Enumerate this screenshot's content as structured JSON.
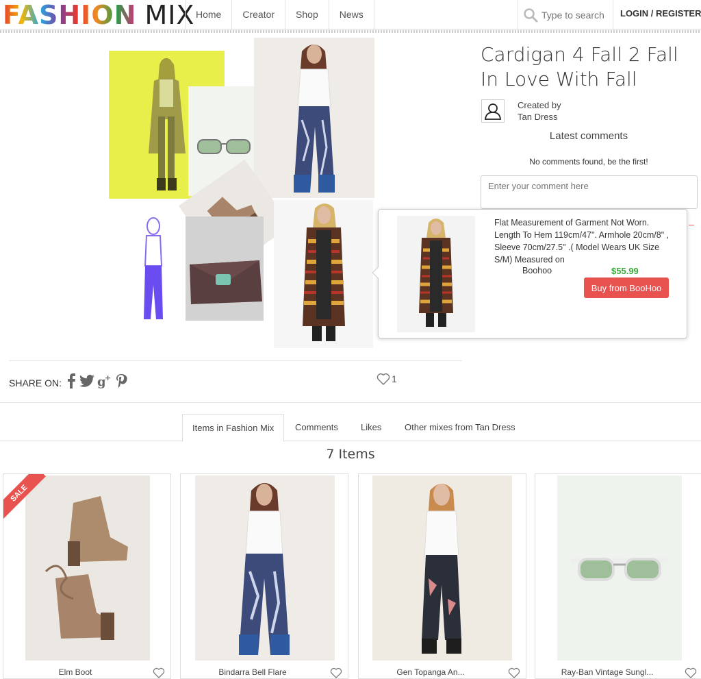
{
  "header": {
    "logo_part1": "FASHION",
    "logo_part2": "MIX",
    "nav": [
      "Home",
      "Creator",
      "Shop",
      "News"
    ],
    "search_placeholder": "Type to search",
    "login_label": "LOGIN / REGISTER"
  },
  "mix": {
    "title": "Cardigan 4 Fall 2 Fall In Love With Fall",
    "created_by_label": "Created by",
    "creator_name": "Tan Dress",
    "latest_comments_heading": "Latest comments",
    "no_comments_text": "No comments found, be the first!",
    "comment_placeholder": "Enter your comment here",
    "share_label": "SHARE ON:",
    "like_count": "1"
  },
  "popup": {
    "description": "Flat Measurement of Garment Not Worn. Length To Hem 119cm/47\". Armhole 20cm/8\" , Sleeve 70cm/27.5\" .( Model Wears UK Size S/M) Measured on",
    "brand": "Boohoo",
    "price": "$55.99",
    "buy_label": "Buy from BooHoo"
  },
  "tabs": [
    "Items in Fashion Mix",
    "Comments",
    "Likes",
    "Other mixes from Tan Dress"
  ],
  "items_count": "7 Items",
  "items": [
    {
      "name": "Elm Boot",
      "sale": "SALE"
    },
    {
      "name": "Bindarra Bell Flare",
      "sale": ""
    },
    {
      "name": "Gen Topanga An...",
      "sale": ""
    },
    {
      "name": "Ray-Ban Vintage Sungl...",
      "sale": ""
    }
  ],
  "colors": {
    "accent_red": "#e8524f",
    "price_green": "#3aaa3a",
    "collage_yellow": "#e8ee4a",
    "collage_purple": "#7b5cf0"
  }
}
